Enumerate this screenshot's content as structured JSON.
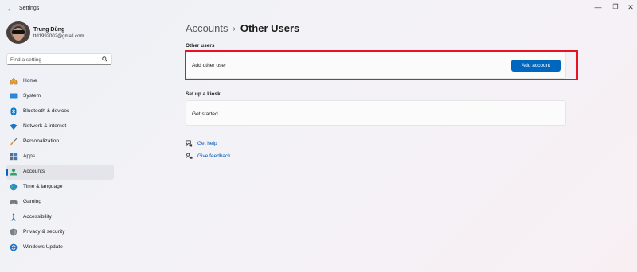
{
  "window": {
    "app_title": "Settings",
    "controls": {
      "minimize": "—",
      "maximize": "❐",
      "close": "✕"
    }
  },
  "profile": {
    "name": "Trung Dũng",
    "email": "ttd1992002@gmail.com"
  },
  "search": {
    "placeholder": "Find a setting",
    "value": ""
  },
  "sidebar": {
    "items": [
      {
        "label": "Home",
        "icon": "home-icon",
        "active": false
      },
      {
        "label": "System",
        "icon": "system-icon",
        "active": false
      },
      {
        "label": "Bluetooth & devices",
        "icon": "bluetooth-icon",
        "active": false
      },
      {
        "label": "Network & internet",
        "icon": "wifi-icon",
        "active": false
      },
      {
        "label": "Personalization",
        "icon": "brush-icon",
        "active": false
      },
      {
        "label": "Apps",
        "icon": "apps-icon",
        "active": false
      },
      {
        "label": "Accounts",
        "icon": "accounts-icon",
        "active": true
      },
      {
        "label": "Time & language",
        "icon": "globe-icon",
        "active": false
      },
      {
        "label": "Gaming",
        "icon": "gaming-icon",
        "active": false
      },
      {
        "label": "Accessibility",
        "icon": "accessibility-icon",
        "active": false
      },
      {
        "label": "Privacy & security",
        "icon": "shield-icon",
        "active": false
      },
      {
        "label": "Windows Update",
        "icon": "update-icon",
        "active": false
      }
    ]
  },
  "breadcrumb": {
    "parent": "Accounts",
    "separator": "›",
    "current": "Other Users"
  },
  "main": {
    "other_users": {
      "heading": "Other users",
      "row_label": "Add other user",
      "button_label": "Add account"
    },
    "kiosk": {
      "heading": "Set up a kiosk",
      "row_label": "Get started"
    },
    "links": [
      {
        "label": "Get help",
        "icon": "help-icon"
      },
      {
        "label": "Give feedback",
        "icon": "feedback-icon"
      }
    ]
  },
  "colors": {
    "accent": "#0067c0",
    "highlight_border": "#e81224",
    "link": "#0058b0"
  }
}
